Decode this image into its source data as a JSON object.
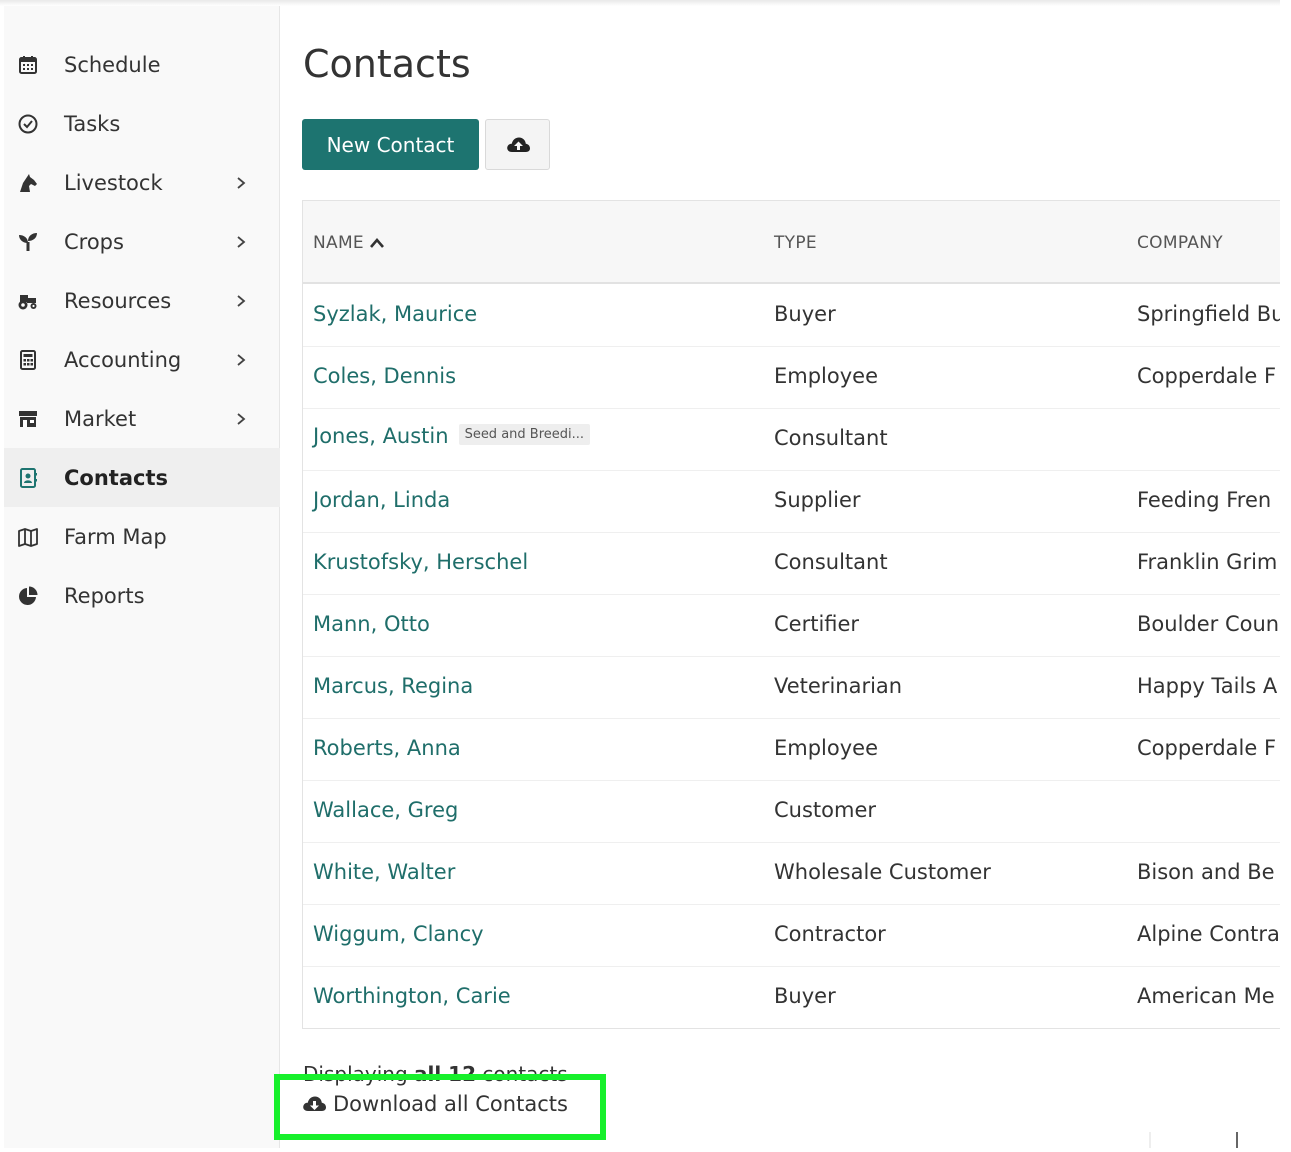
{
  "sidebar": {
    "items": [
      {
        "label": "Schedule",
        "icon": "calendar-icon",
        "chevron": false,
        "active": false
      },
      {
        "label": "Tasks",
        "icon": "check-circle-icon",
        "chevron": false,
        "active": false
      },
      {
        "label": "Livestock",
        "icon": "horse-icon",
        "chevron": true,
        "active": false
      },
      {
        "label": "Crops",
        "icon": "seedling-icon",
        "chevron": true,
        "active": false
      },
      {
        "label": "Resources",
        "icon": "tractor-icon",
        "chevron": true,
        "active": false
      },
      {
        "label": "Accounting",
        "icon": "calculator-icon",
        "chevron": true,
        "active": false
      },
      {
        "label": "Market",
        "icon": "store-icon",
        "chevron": true,
        "active": false
      },
      {
        "label": "Contacts",
        "icon": "address-book-icon",
        "chevron": false,
        "active": true
      },
      {
        "label": "Farm Map",
        "icon": "map-icon",
        "chevron": false,
        "active": false
      },
      {
        "label": "Reports",
        "icon": "pie-chart-icon",
        "chevron": false,
        "active": false
      }
    ]
  },
  "main": {
    "title": "Contacts",
    "new_contact_label": "New Contact",
    "upload_icon": "cloud-upload-icon",
    "table": {
      "columns": [
        "NAME",
        "TYPE",
        "COMPANY"
      ],
      "sort_column": "NAME",
      "sort_direction": "ascending",
      "rows": [
        {
          "name": "Syzlak, Maurice",
          "tag": "",
          "type": "Buyer",
          "company": "Springfield Bu"
        },
        {
          "name": "Coles, Dennis",
          "tag": "",
          "type": "Employee",
          "company": "Copperdale F"
        },
        {
          "name": "Jones, Austin",
          "tag": "Seed and Breedi...",
          "type": "Consultant",
          "company": ""
        },
        {
          "name": "Jordan, Linda",
          "tag": "",
          "type": "Supplier",
          "company": "Feeding Fren"
        },
        {
          "name": "Krustofsky, Herschel",
          "tag": "",
          "type": "Consultant",
          "company": "Franklin Grim"
        },
        {
          "name": "Mann, Otto",
          "tag": "",
          "type": "Certifier",
          "company": "Boulder Coun"
        },
        {
          "name": "Marcus, Regina",
          "tag": "",
          "type": "Veterinarian",
          "company": "Happy Tails A"
        },
        {
          "name": "Roberts, Anna",
          "tag": "",
          "type": "Employee",
          "company": "Copperdale F"
        },
        {
          "name": "Wallace, Greg",
          "tag": "",
          "type": "Customer",
          "company": ""
        },
        {
          "name": "White, Walter",
          "tag": "",
          "type": "Wholesale Customer",
          "company": "Bison and Be"
        },
        {
          "name": "Wiggum, Clancy",
          "tag": "",
          "type": "Contractor",
          "company": "Alpine Contra"
        },
        {
          "name": "Worthington, Carie",
          "tag": "",
          "type": "Buyer",
          "company": "American Me"
        }
      ]
    },
    "summary": {
      "prefix": "Displaying ",
      "bold": "all 12",
      "suffix": " contacts"
    },
    "download_label": "Download all Contacts",
    "download_icon": "cloud-download-icon"
  },
  "colors": {
    "accent": "#1d7470",
    "link": "#1f6e6a",
    "highlight": "#17f02b",
    "sidebar_bg": "#f9f9f9",
    "sidebar_active_bg": "#efefef"
  }
}
